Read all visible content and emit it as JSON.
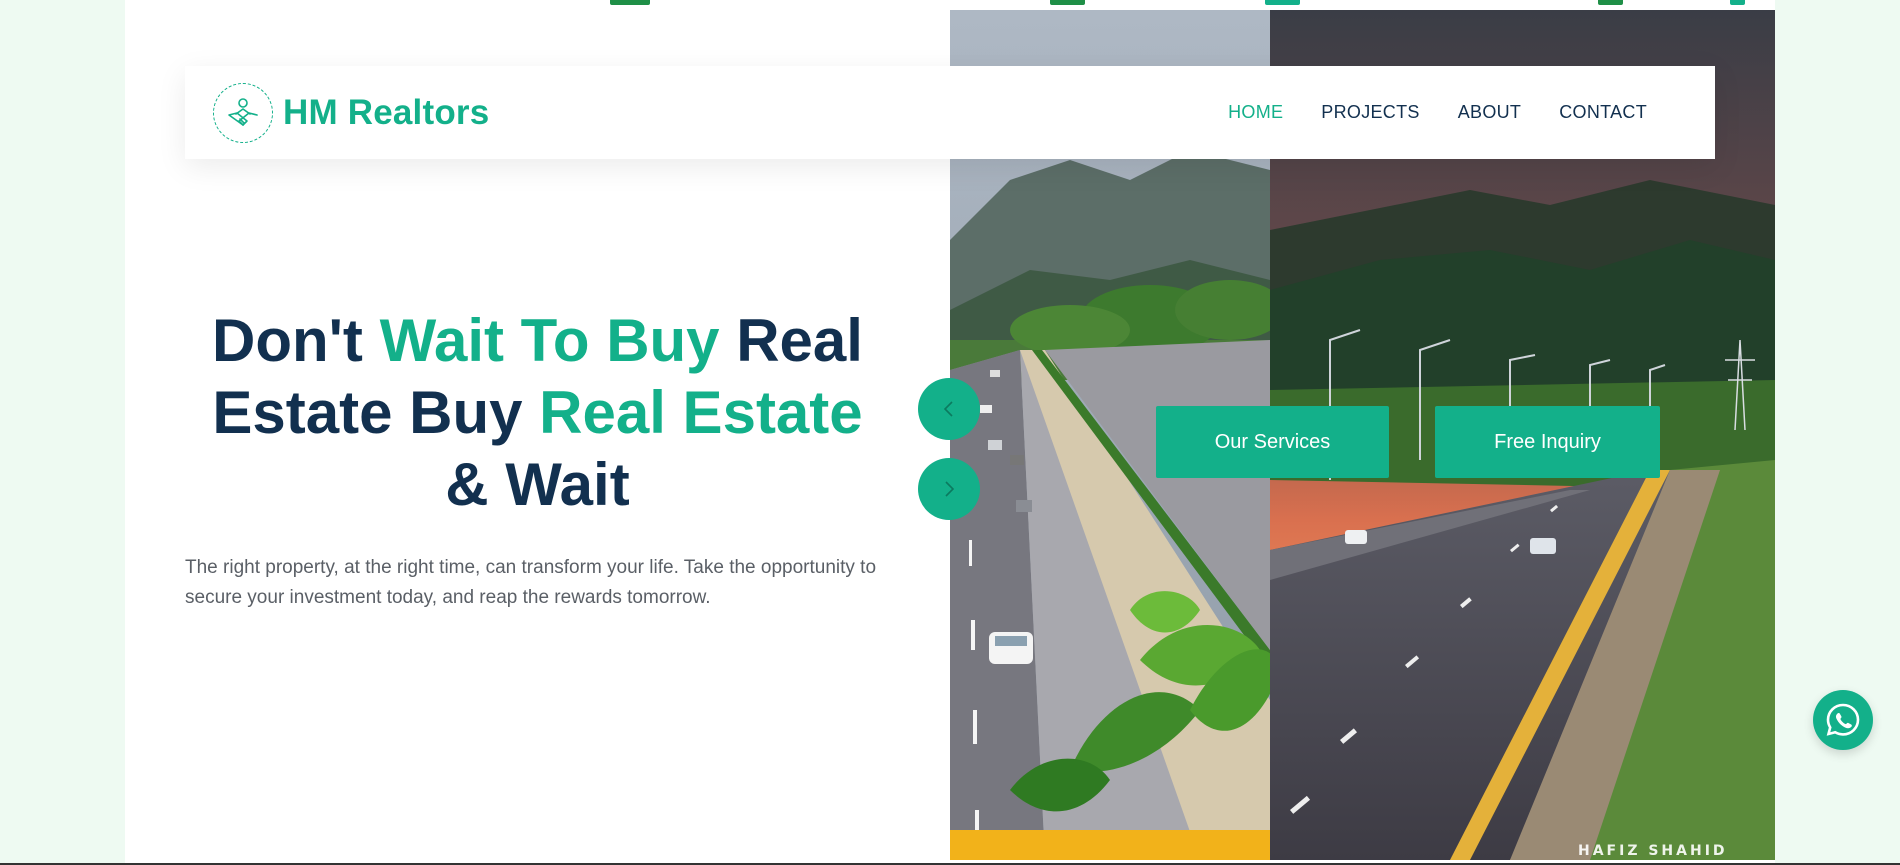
{
  "brand": {
    "name": "HM Realtors",
    "logo_icon": "handshake-icon"
  },
  "nav": {
    "items": [
      {
        "label": "HOME",
        "active": true
      },
      {
        "label": "PROJECTS",
        "active": false
      },
      {
        "label": "ABOUT",
        "active": false
      },
      {
        "label": "CONTACT",
        "active": false
      }
    ]
  },
  "hero": {
    "headline": {
      "part1": "Don't ",
      "accent1": "Wait To Buy",
      "part2": " Real Estate Buy ",
      "accent2": "Real Estate",
      "part3": " & Wait"
    },
    "lead": "The right property, at the right time, can transform your life. Take the opportunity to secure your investment today, and reap the rewards tomorrow.",
    "buttons": {
      "services": "Our Services",
      "inquiry": "Free Inquiry"
    },
    "image_watermark": "HAFIZ SHAHID",
    "slider": {
      "prev_icon": "chevron-left-icon",
      "next_icon": "chevron-right-icon"
    }
  },
  "floating": {
    "whatsapp_icon": "whatsapp-icon"
  },
  "colors": {
    "accent": "#13b08a",
    "navy": "#12304f",
    "text_muted": "#5a5f66",
    "page_bg": "#eefaf2"
  }
}
